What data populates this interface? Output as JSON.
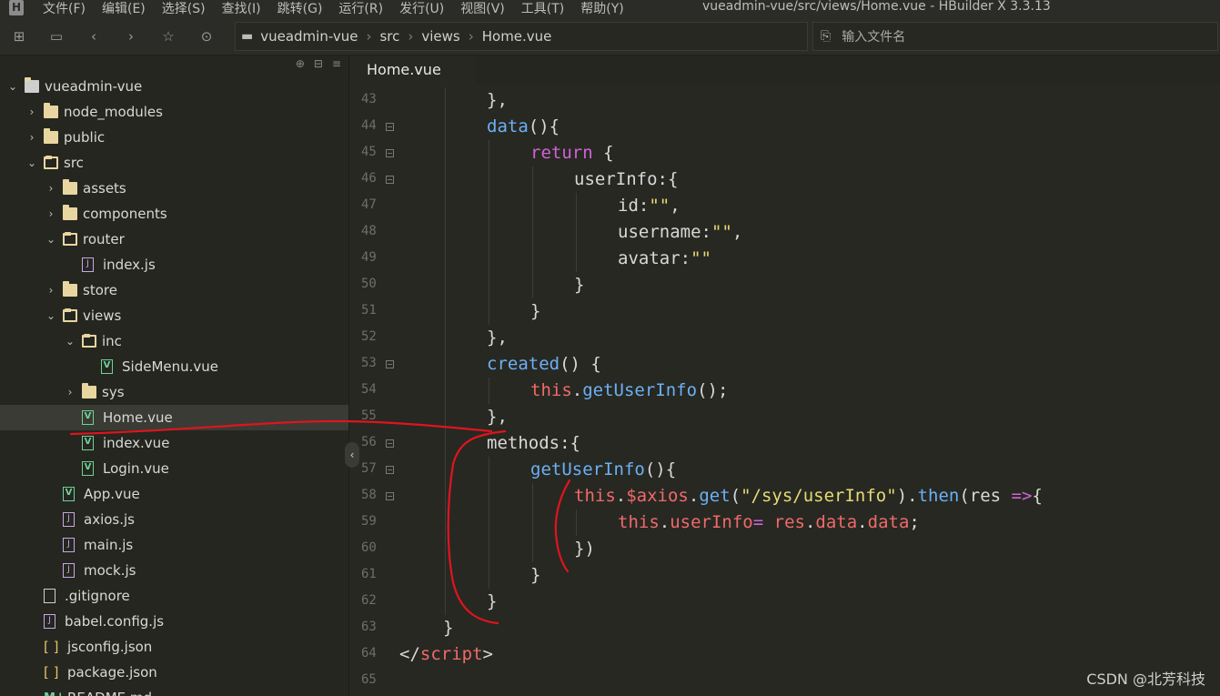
{
  "app": {
    "logo": "H",
    "title": "vueadmin-vue/src/views/Home.vue - HBuilder X 3.3.13"
  },
  "menu": [
    "文件(F)",
    "编辑(E)",
    "选择(S)",
    "查找(I)",
    "跳转(G)",
    "运行(R)",
    "发行(U)",
    "视图(V)",
    "工具(T)",
    "帮助(Y)"
  ],
  "breadcrumb": [
    "vueadmin-vue",
    "src",
    "views",
    "Home.vue"
  ],
  "file_search": {
    "placeholder": "输入文件名"
  },
  "tab": {
    "label": "Home.vue"
  },
  "tree": [
    {
      "label": "vueadmin-vue",
      "depth": 0,
      "type": "root",
      "expanded": true
    },
    {
      "label": "node_modules",
      "depth": 1,
      "type": "folder",
      "expanded": false
    },
    {
      "label": "public",
      "depth": 1,
      "type": "folder",
      "expanded": false
    },
    {
      "label": "src",
      "depth": 1,
      "type": "folder",
      "expanded": true
    },
    {
      "label": "assets",
      "depth": 2,
      "type": "folder",
      "expanded": false
    },
    {
      "label": "components",
      "depth": 2,
      "type": "folder",
      "expanded": false
    },
    {
      "label": "router",
      "depth": 2,
      "type": "folder",
      "expanded": true
    },
    {
      "label": "index.js",
      "depth": 3,
      "type": "js"
    },
    {
      "label": "store",
      "depth": 2,
      "type": "folder",
      "expanded": false
    },
    {
      "label": "views",
      "depth": 2,
      "type": "folder",
      "expanded": true
    },
    {
      "label": "inc",
      "depth": 3,
      "type": "folder",
      "expanded": true
    },
    {
      "label": "SideMenu.vue",
      "depth": 4,
      "type": "vue"
    },
    {
      "label": "sys",
      "depth": 3,
      "type": "folder",
      "expanded": false
    },
    {
      "label": "Home.vue",
      "depth": 3,
      "type": "vue",
      "selected": true
    },
    {
      "label": "index.vue",
      "depth": 3,
      "type": "vue"
    },
    {
      "label": "Login.vue",
      "depth": 3,
      "type": "vue"
    },
    {
      "label": "App.vue",
      "depth": 2,
      "type": "vue"
    },
    {
      "label": "axios.js",
      "depth": 2,
      "type": "js"
    },
    {
      "label": "main.js",
      "depth": 2,
      "type": "js"
    },
    {
      "label": "mock.js",
      "depth": 2,
      "type": "js"
    },
    {
      "label": ".gitignore",
      "depth": 1,
      "type": "plain"
    },
    {
      "label": "babel.config.js",
      "depth": 1,
      "type": "js"
    },
    {
      "label": "jsconfig.json",
      "depth": 1,
      "type": "json"
    },
    {
      "label": "package.json",
      "depth": 1,
      "type": "json"
    },
    {
      "label": "README.md",
      "depth": 1,
      "type": "md"
    }
  ],
  "code": [
    {
      "n": "43",
      "fold": false,
      "indent": 2,
      "tokens": [
        [
          "p",
          "},"
        ]
      ]
    },
    {
      "n": "44",
      "fold": true,
      "indent": 2,
      "tokens": [
        [
          "f",
          "data"
        ],
        [
          "p",
          "(){"
        ]
      ]
    },
    {
      "n": "45",
      "fold": true,
      "indent": 3,
      "tokens": [
        [
          "k",
          "return"
        ],
        [
          "p",
          " {"
        ]
      ]
    },
    {
      "n": "46",
      "fold": true,
      "indent": 4,
      "tokens": [
        [
          "p",
          "userInfo:{"
        ]
      ]
    },
    {
      "n": "47",
      "fold": false,
      "indent": 5,
      "tokens": [
        [
          "p",
          "id:"
        ],
        [
          "s",
          "\"\""
        ],
        [
          "p",
          ","
        ]
      ]
    },
    {
      "n": "48",
      "fold": false,
      "indent": 5,
      "tokens": [
        [
          "p",
          "username:"
        ],
        [
          "s",
          "\"\""
        ],
        [
          "p",
          ","
        ]
      ]
    },
    {
      "n": "49",
      "fold": false,
      "indent": 5,
      "tokens": [
        [
          "p",
          "avatar:"
        ],
        [
          "s",
          "\"\""
        ]
      ]
    },
    {
      "n": "50",
      "fold": false,
      "indent": 4,
      "tokens": [
        [
          "p",
          "}"
        ]
      ]
    },
    {
      "n": "51",
      "fold": false,
      "indent": 3,
      "tokens": [
        [
          "p",
          "}"
        ]
      ]
    },
    {
      "n": "52",
      "fold": false,
      "indent": 2,
      "tokens": [
        [
          "p",
          "},"
        ]
      ]
    },
    {
      "n": "53",
      "fold": true,
      "indent": 2,
      "tokens": [
        [
          "f",
          "created"
        ],
        [
          "p",
          "() {"
        ]
      ]
    },
    {
      "n": "54",
      "fold": false,
      "indent": 3,
      "tokens": [
        [
          "t",
          "this"
        ],
        [
          "p",
          "."
        ],
        [
          "f",
          "getUserInfo"
        ],
        [
          "p",
          "();"
        ]
      ]
    },
    {
      "n": "55",
      "fold": false,
      "indent": 2,
      "tokens": [
        [
          "p",
          "},"
        ]
      ]
    },
    {
      "n": "56",
      "fold": true,
      "indent": 2,
      "tokens": [
        [
          "p",
          "methods:{"
        ]
      ]
    },
    {
      "n": "57",
      "fold": true,
      "indent": 3,
      "tokens": [
        [
          "f",
          "getUserInfo"
        ],
        [
          "p",
          "(){"
        ]
      ]
    },
    {
      "n": "58",
      "fold": true,
      "indent": 4,
      "tokens": [
        [
          "t",
          "this"
        ],
        [
          "p",
          "."
        ],
        [
          "t",
          "$axios"
        ],
        [
          "p",
          "."
        ],
        [
          "f",
          "get"
        ],
        [
          "p",
          "("
        ],
        [
          "s",
          "\"/sys/userInfo\""
        ],
        [
          "p",
          ")."
        ],
        [
          "f",
          "then"
        ],
        [
          "p",
          "(res "
        ],
        [
          "k",
          "=>"
        ],
        [
          "p",
          "{"
        ]
      ]
    },
    {
      "n": "59",
      "fold": false,
      "indent": 5,
      "tokens": [
        [
          "t",
          "this"
        ],
        [
          "p",
          "."
        ],
        [
          "t",
          "userInfo"
        ],
        [
          "k",
          "="
        ],
        [
          "t",
          " res"
        ],
        [
          "p",
          "."
        ],
        [
          "t",
          "data"
        ],
        [
          "p",
          "."
        ],
        [
          "t",
          "data"
        ],
        [
          "p",
          ";"
        ]
      ]
    },
    {
      "n": "60",
      "fold": false,
      "indent": 4,
      "tokens": [
        [
          "p",
          "})"
        ]
      ]
    },
    {
      "n": "61",
      "fold": false,
      "indent": 3,
      "tokens": [
        [
          "p",
          "}"
        ]
      ]
    },
    {
      "n": "62",
      "fold": false,
      "indent": 2,
      "tokens": [
        [
          "p",
          "}"
        ]
      ]
    },
    {
      "n": "63",
      "fold": false,
      "indent": 1,
      "tokens": [
        [
          "p",
          "}"
        ]
      ]
    },
    {
      "n": "64",
      "fold": false,
      "indent": 0,
      "tokens": [
        [
          "p",
          "</"
        ],
        [
          "t",
          "script"
        ],
        [
          "p",
          ">"
        ]
      ]
    },
    {
      "n": "65",
      "fold": false,
      "indent": 0,
      "tokens": []
    }
  ],
  "colors": {
    "keyword": "#cf63d9",
    "function": "#6cb0f5",
    "string": "#e6db74",
    "variable": "#f06a6a",
    "annotation": "#e0141e"
  },
  "watermark": "CSDN @北芳科技"
}
